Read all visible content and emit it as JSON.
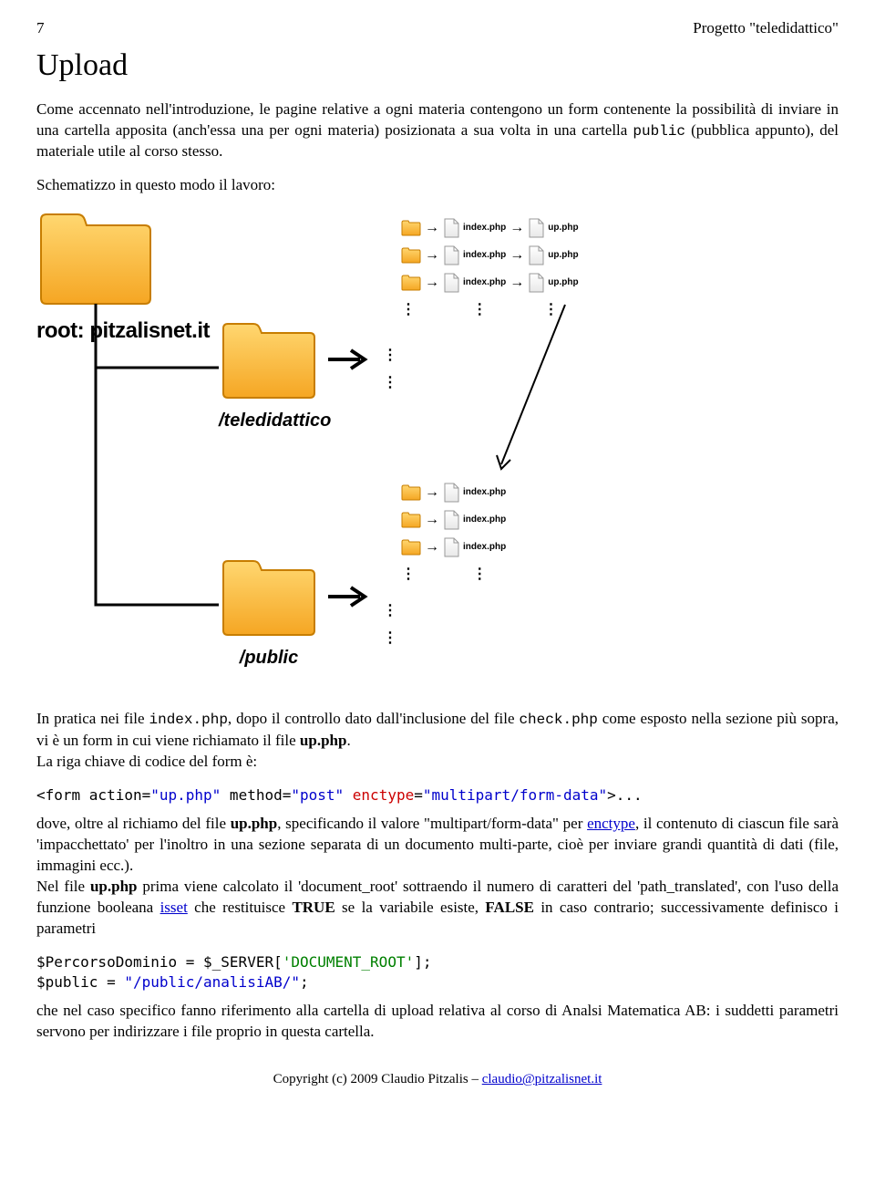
{
  "header": {
    "page_num": "7",
    "title": "Progetto \"teledidattico\""
  },
  "h1": "Upload",
  "para1_a": "Come accennato nell'introduzione, le pagine relative a ogni materia contengono un form contenente la possibilità di inviare in una cartella apposita (anch'essa una per ogni materia) posizionata a sua volta in una cartella ",
  "para1_code": "public",
  "para1_b": " (pubblica appunto), del materiale utile al corso stesso.",
  "para2": "Schematizzo in questo modo il lavoro:",
  "diagram": {
    "root_label": "root: pitzalisnet.it",
    "teledidattico": "/teledidattico",
    "public": "/public",
    "index": "index.php",
    "up": "up.php"
  },
  "para3_a": "In pratica nei file ",
  "para3_code1": "index.php",
  "para3_b": ", dopo il controllo dato dall'inclusione del file ",
  "para3_code2": "check.php",
  "para3_c": " come esposto nella sezione più sopra, vi è un form in cui viene richiamato il file ",
  "para3_bold1": "up.php",
  "para3_d": ".\nLa riga chiave di codice del form è:",
  "code1_a": "<form action=",
  "code1_b": "\"up.php\"",
  "code1_c": " method=",
  "code1_d": "\"post\"",
  "code1_e": " enctype",
  "code1_f": "=",
  "code1_g": "\"multipart/form-data\"",
  "code1_h": ">...",
  "para4_a": "dove, oltre al richiamo del file ",
  "para4_bold": "up.php",
  "para4_b": ", specificando il valore \"multipart/form-data\" per ",
  "para4_link": "enctype",
  "para4_c": ", il contenuto di ciascun file sarà 'impacchettato' per l'inoltro in una sezione separata di un documento multi-parte, cioè per inviare grandi quantità di dati (file, immagini ecc.).",
  "para5_a": "Nel file ",
  "para5_bold1": "up.php",
  "para5_b": " prima viene calcolato il 'document_root' sottraendo il numero di caratteri del 'path_translated', con l'uso della funzione booleana ",
  "para5_link": "isset",
  "para5_c": " che restituisce ",
  "para5_bold2": "TRUE",
  "para5_d": " se la variabile esiste, ",
  "para5_bold3": "FALSE",
  "para5_e": " in caso contrario; successivamente definisco i parametri",
  "code2_a": "$PercorsoDominio = $_SERVER[",
  "code2_b": "'DOCUMENT_ROOT'",
  "code2_c": "];",
  "code2_d": "$public = ",
  "code2_e": "\"/public/analisiAB/\"",
  "code2_f": ";",
  "para6": "che nel caso specifico fanno riferimento alla cartella di upload relativa al corso di Analsi Matematica AB: i suddetti parametri servono per indirizzare i file proprio in questa cartella.",
  "footer_a": "Copyright (c) 2009 Claudio Pitzalis – ",
  "footer_link": "claudio@pitzalisnet.it"
}
